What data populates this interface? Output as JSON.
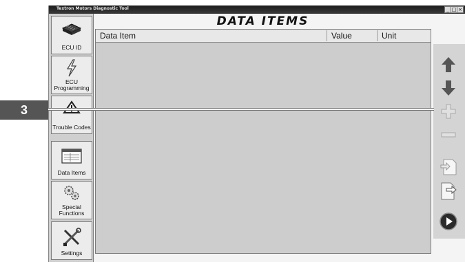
{
  "window": {
    "title": "Textron Motors Diagnostic Tool",
    "controls": [
      "_",
      "□",
      "×"
    ]
  },
  "sidebar": {
    "items": [
      {
        "label": "ECU ID",
        "icon": "chip-icon"
      },
      {
        "label": "ECU Programming",
        "icon": "lightning-icon"
      },
      {
        "label": "Trouble Codes",
        "icon": "warning-icon"
      },
      {
        "label": "Data Items",
        "icon": "data-table-icon"
      },
      {
        "label": "Special Functions",
        "icon": "gears-icon"
      },
      {
        "label": "Settings",
        "icon": "tools-icon"
      }
    ]
  },
  "main": {
    "title": "DATA ITEMS",
    "table": {
      "columns": [
        "Data Item",
        "Value",
        "Unit"
      ],
      "rows": []
    }
  },
  "toolbar": {
    "buttons": [
      {
        "name": "move-up",
        "icon": "arrow-up-icon",
        "enabled": true
      },
      {
        "name": "move-down",
        "icon": "arrow-down-icon",
        "enabled": true
      },
      {
        "name": "add",
        "icon": "plus-icon",
        "enabled": false
      },
      {
        "name": "remove",
        "icon": "minus-icon",
        "enabled": false
      },
      {
        "name": "import",
        "icon": "import-icon",
        "enabled": false
      },
      {
        "name": "export",
        "icon": "export-icon",
        "enabled": true
      },
      {
        "name": "play",
        "icon": "play-icon",
        "enabled": true
      }
    ]
  },
  "callout": {
    "label": "3"
  },
  "colors": {
    "titlebar": "#2a2a2a",
    "panel": "#cdcdcd",
    "callout": "#555555",
    "arrow_enabled": "#555555",
    "arrow_disabled": "#a8a8a8"
  }
}
